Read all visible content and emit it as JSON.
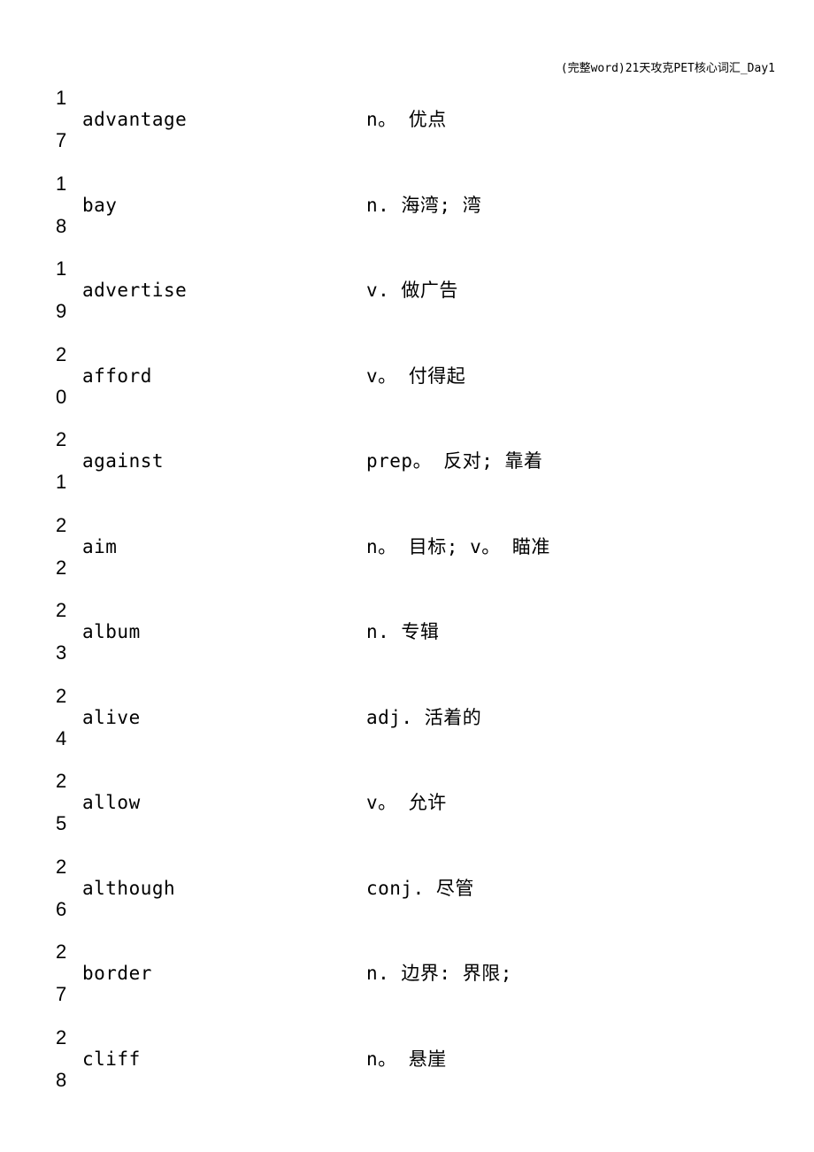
{
  "header": {
    "title": "(完整word)21天攻克PET核心词汇_Day1"
  },
  "entries": [
    {
      "num_top": "1",
      "num_bottom": "7",
      "word": "advantage",
      "definition": "n。 优点"
    },
    {
      "num_top": "1",
      "num_bottom": "8",
      "word": "bay",
      "definition": "n. 海湾; 湾"
    },
    {
      "num_top": "1",
      "num_bottom": "9",
      "word": "advertise",
      "definition": "v. 做广告"
    },
    {
      "num_top": "2",
      "num_bottom": "0",
      "word": "afford",
      "definition": "v。 付得起"
    },
    {
      "num_top": "2",
      "num_bottom": "1",
      "word": "against",
      "definition": "prep。 反对; 靠着"
    },
    {
      "num_top": "2",
      "num_bottom": "2",
      "word": "aim",
      "definition": "n。 目标; v。 瞄准"
    },
    {
      "num_top": "2",
      "num_bottom": "3",
      "word": "album",
      "definition": "n. 专辑"
    },
    {
      "num_top": "2",
      "num_bottom": "4",
      "word": "alive",
      "definition": "adj. 活着的"
    },
    {
      "num_top": "2",
      "num_bottom": "5",
      "word": "allow",
      "definition": "v。 允许"
    },
    {
      "num_top": "2",
      "num_bottom": "6",
      "word": "although",
      "definition": "conj. 尽管"
    },
    {
      "num_top": "2",
      "num_bottom": "7",
      "word": "border",
      "definition": "n. 边界: 界限;"
    },
    {
      "num_top": "2",
      "num_bottom": "8",
      "word": "cliff",
      "definition": "n。 悬崖"
    }
  ]
}
